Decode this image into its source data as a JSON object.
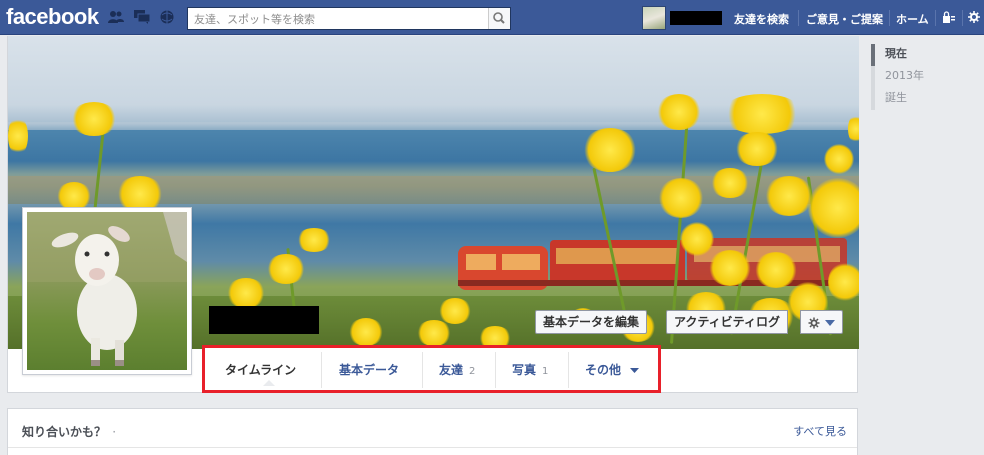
{
  "topbar": {
    "logo": "facebook",
    "search_placeholder": "友達、スポット等を検索",
    "nav": {
      "find_friends": "友達を検索",
      "feedback": "ご意見・ご提案",
      "home": "ホーム"
    },
    "icons": [
      "friends-icon",
      "messages-icon",
      "notifications-icon",
      "search-icon",
      "privacy-lock-icon",
      "settings-gear-icon"
    ]
  },
  "profile": {
    "buttons": {
      "edit_info": "基本データを編集",
      "activity_log": "アクティビティログ"
    },
    "tabs": [
      {
        "label": "タイムライン",
        "count": ""
      },
      {
        "label": "基本データ",
        "count": ""
      },
      {
        "label": "友達",
        "count": "2"
      },
      {
        "label": "写真",
        "count": "1"
      },
      {
        "label": "その他",
        "count": ""
      }
    ]
  },
  "pymk": {
    "title": "知り合いかも？",
    "dot": "·",
    "see_all": "すべて見る"
  },
  "scrubber": {
    "items": [
      "現在",
      "2013年",
      "誕生"
    ]
  },
  "colors": {
    "brand": "#3b5998",
    "highlight_box": "#e8202a"
  }
}
